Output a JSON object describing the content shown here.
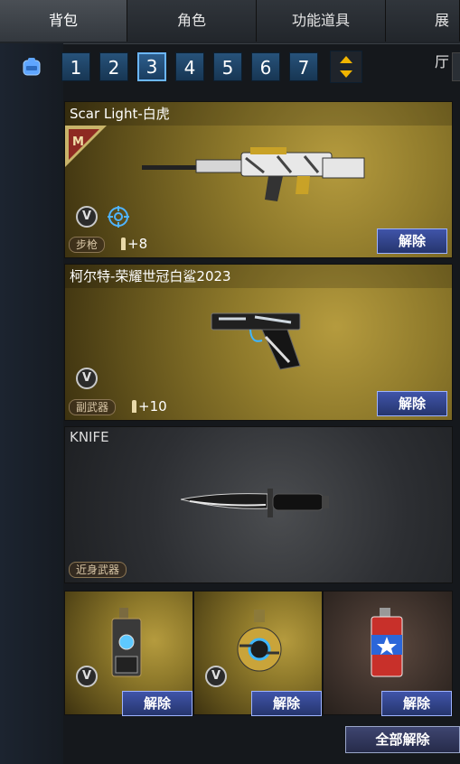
{
  "tabs": [
    {
      "label": "背包",
      "active": true
    },
    {
      "label": "角色",
      "active": false
    },
    {
      "label": "功能道具",
      "active": false
    },
    {
      "label": "展厅",
      "active": false
    }
  ],
  "pagination": {
    "pages": [
      "1",
      "2",
      "3",
      "4",
      "5",
      "6",
      "7"
    ],
    "active_index": 2
  },
  "slots": {
    "primary": {
      "name": "Scar Light-白虎",
      "category": "步枪",
      "ammo_bonus": "+8",
      "button": "解除"
    },
    "secondary": {
      "name": "柯尔特-荣耀世冠白鲨2023",
      "category": "副武器",
      "ammo_bonus": "+10",
      "button": "解除"
    },
    "melee": {
      "name": "KNIFE",
      "category": "近身武器"
    },
    "grenades": [
      {
        "button": "解除"
      },
      {
        "button": "解除"
      },
      {
        "button": "解除"
      }
    ]
  },
  "footer": {
    "unequip_all": "全部解除"
  },
  "colors": {
    "gold": "#8f7a2b",
    "button_blue": "#3b4fa0",
    "page_blue": "#1f4668"
  }
}
